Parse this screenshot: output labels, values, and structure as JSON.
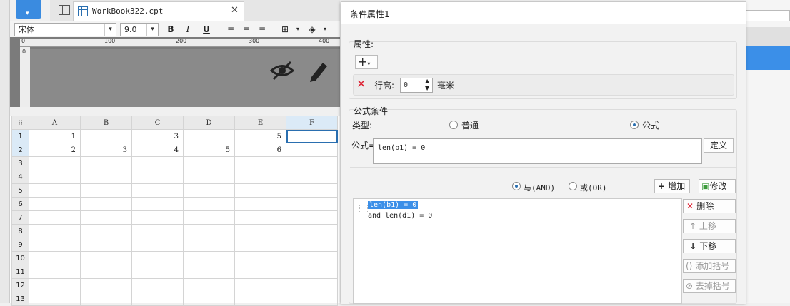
{
  "tab": {
    "filename": "WorkBook322.cpt"
  },
  "toolbar": {
    "font_name": "宋体",
    "font_size": "9.0",
    "bold": "B",
    "italic": "I",
    "underline": "U"
  },
  "ruler": {
    "marks": [
      "0",
      "100",
      "200",
      "300",
      "400"
    ],
    "vmark": "0"
  },
  "sheet": {
    "columns": [
      "A",
      "B",
      "C",
      "D",
      "E",
      "F"
    ],
    "rows": [
      {
        "n": "1",
        "cells": [
          "1",
          "",
          "3",
          "",
          "5",
          ""
        ]
      },
      {
        "n": "2",
        "cells": [
          "2",
          "3",
          "4",
          "5",
          "6",
          ""
        ]
      },
      {
        "n": "3",
        "cells": [
          "",
          "",
          "",
          "",
          "",
          ""
        ]
      },
      {
        "n": "4",
        "cells": [
          "",
          "",
          "",
          "",
          "",
          ""
        ]
      },
      {
        "n": "5",
        "cells": [
          "",
          "",
          "",
          "",
          "",
          ""
        ]
      },
      {
        "n": "6",
        "cells": [
          "",
          "",
          "",
          "",
          "",
          ""
        ]
      },
      {
        "n": "7",
        "cells": [
          "",
          "",
          "",
          "",
          "",
          ""
        ]
      },
      {
        "n": "8",
        "cells": [
          "",
          "",
          "",
          "",
          "",
          ""
        ]
      },
      {
        "n": "9",
        "cells": [
          "",
          "",
          "",
          "",
          "",
          ""
        ]
      },
      {
        "n": "10",
        "cells": [
          "",
          "",
          "",
          "",
          "",
          ""
        ]
      },
      {
        "n": "11",
        "cells": [
          "",
          "",
          "",
          "",
          "",
          ""
        ]
      },
      {
        "n": "12",
        "cells": [
          "",
          "",
          "",
          "",
          "",
          ""
        ]
      },
      {
        "n": "13",
        "cells": [
          "",
          "",
          "",
          "",
          "",
          ""
        ]
      }
    ],
    "active_cell": "F1"
  },
  "dialog": {
    "title": "条件属性1",
    "attr_section": "属性:",
    "row_height_label": "行高:",
    "row_height_value": "0",
    "row_height_unit": "毫米",
    "formula_section": "公式条件",
    "type_label": "类型:",
    "type_normal": "普通",
    "type_formula": "公式",
    "formula_label": "公式=",
    "formula_value": "len(b1) = 0",
    "define_button": "定义",
    "and_label": "与(AND)",
    "or_label": "或(OR)",
    "add_button": "增加",
    "modify_button": "修改",
    "conditions": [
      "len(b1) = 0",
      "and len(d1) = 0"
    ],
    "delete_button": "删除",
    "move_up_button": "上移",
    "move_down_button": "下移",
    "add_bracket_button": "添加括号",
    "remove_bracket_button": "去掉括号"
  },
  "colors": {
    "accent": "#2a6fb0",
    "selection": "#3b8fe8",
    "delete_red": "#dd2233"
  }
}
